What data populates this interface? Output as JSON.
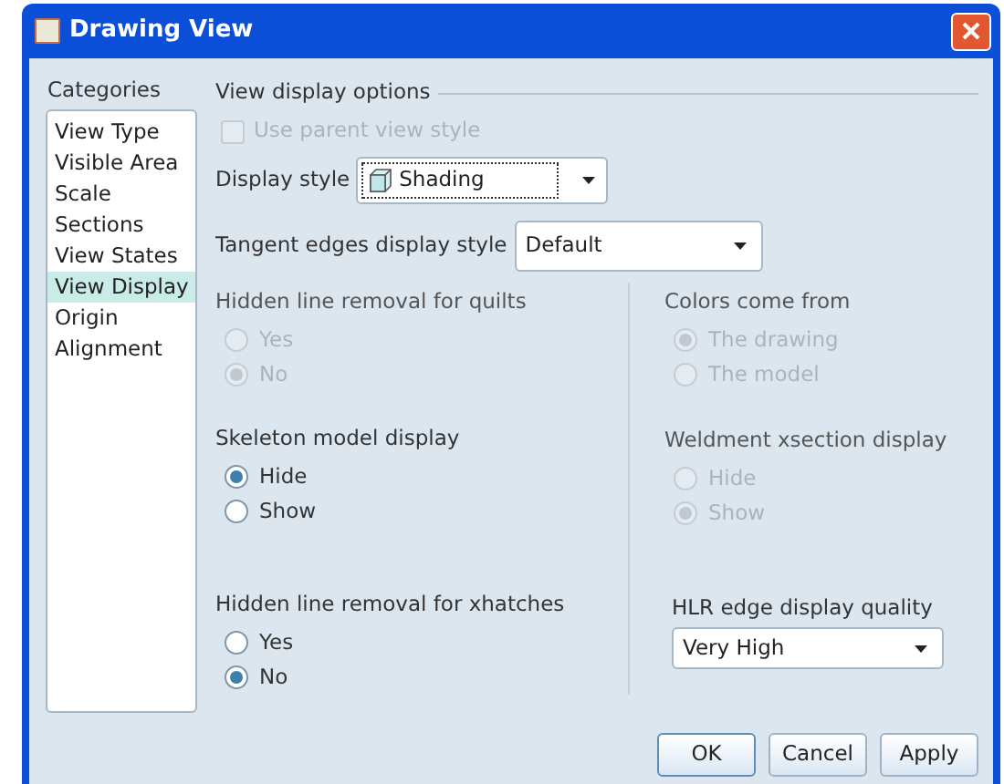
{
  "window": {
    "title": "Drawing View"
  },
  "categories": {
    "label": "Categories",
    "items": [
      {
        "label": "View Type",
        "selected": false
      },
      {
        "label": "Visible Area",
        "selected": false
      },
      {
        "label": "Scale",
        "selected": false
      },
      {
        "label": "Sections",
        "selected": false
      },
      {
        "label": "View States",
        "selected": false
      },
      {
        "label": "View Display",
        "selected": true
      },
      {
        "label": "Origin",
        "selected": false
      },
      {
        "label": "Alignment",
        "selected": false
      }
    ]
  },
  "options": {
    "title": "View display options",
    "use_parent": {
      "label": "Use parent view style",
      "checked": false,
      "disabled": true
    },
    "display_style": {
      "label": "Display style",
      "value": "Shading"
    },
    "tangent": {
      "label": "Tangent edges display style",
      "value": "Default"
    },
    "left_groups": [
      {
        "title": "Hidden line removal for quilts",
        "disabled": true,
        "options": [
          {
            "label": "Yes",
            "selected": false
          },
          {
            "label": "No",
            "selected": true
          }
        ]
      },
      {
        "title": "Skeleton model display",
        "disabled": false,
        "options": [
          {
            "label": "Hide",
            "selected": true
          },
          {
            "label": "Show",
            "selected": false
          }
        ]
      },
      {
        "title": "Hidden line removal for xhatches",
        "disabled": false,
        "options": [
          {
            "label": "Yes",
            "selected": false
          },
          {
            "label": "No",
            "selected": true
          }
        ]
      }
    ],
    "right_groups": [
      {
        "title": "Colors come from",
        "disabled": true,
        "options": [
          {
            "label": "The drawing",
            "selected": true
          },
          {
            "label": "The model",
            "selected": false
          }
        ]
      },
      {
        "title": "Weldment xsection display",
        "disabled": true,
        "options": [
          {
            "label": "Hide",
            "selected": false
          },
          {
            "label": "Show",
            "selected": true
          }
        ]
      }
    ],
    "hlr_quality": {
      "label": "HLR edge display quality",
      "value": "Very High"
    }
  },
  "buttons": [
    {
      "label": "OK",
      "default": true
    },
    {
      "label": "Cancel",
      "default": false
    },
    {
      "label": "Apply",
      "default": false
    }
  ]
}
